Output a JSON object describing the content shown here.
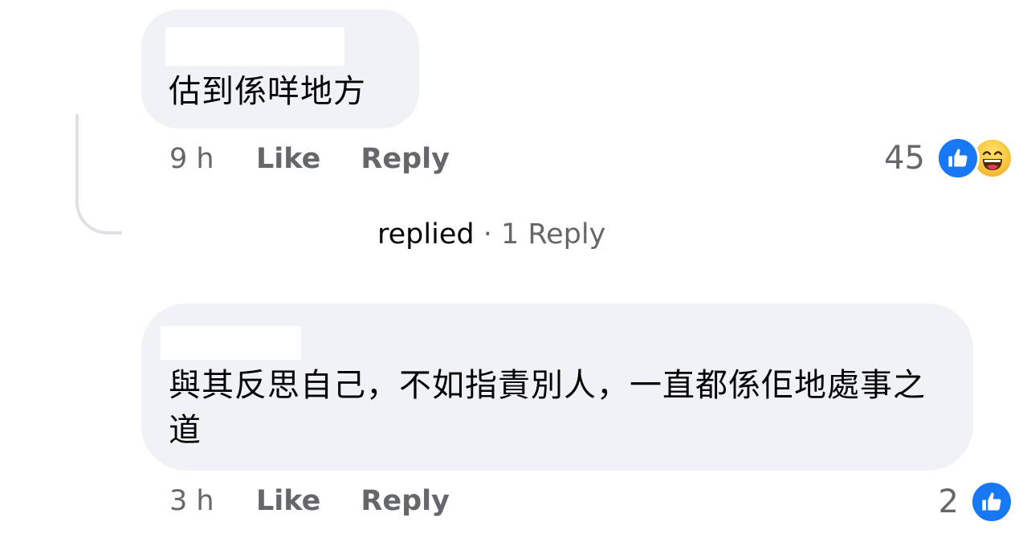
{
  "comments": [
    {
      "text": "估到係咩地方",
      "time": "9 h",
      "like_label": "Like",
      "reply_label": "Reply",
      "reaction_count": "45",
      "reaction_icons": [
        "like-icon",
        "haha-icon"
      ]
    },
    {
      "text": "與其反思自己，不如指責別人，一直都係佢地處事之道",
      "time": "3 h",
      "like_label": "Like",
      "reply_label": "Reply",
      "reaction_count": "2",
      "reaction_icons": [
        "like-icon"
      ]
    }
  ],
  "replies_summary": {
    "replied_label": "replied",
    "separator": "·",
    "count_label": "1 Reply"
  },
  "colors": {
    "bubble": "#f0f2f5",
    "secondary_text": "#65676b",
    "like_blue": "#1877f2",
    "thread_line": "#dfe1e5"
  }
}
